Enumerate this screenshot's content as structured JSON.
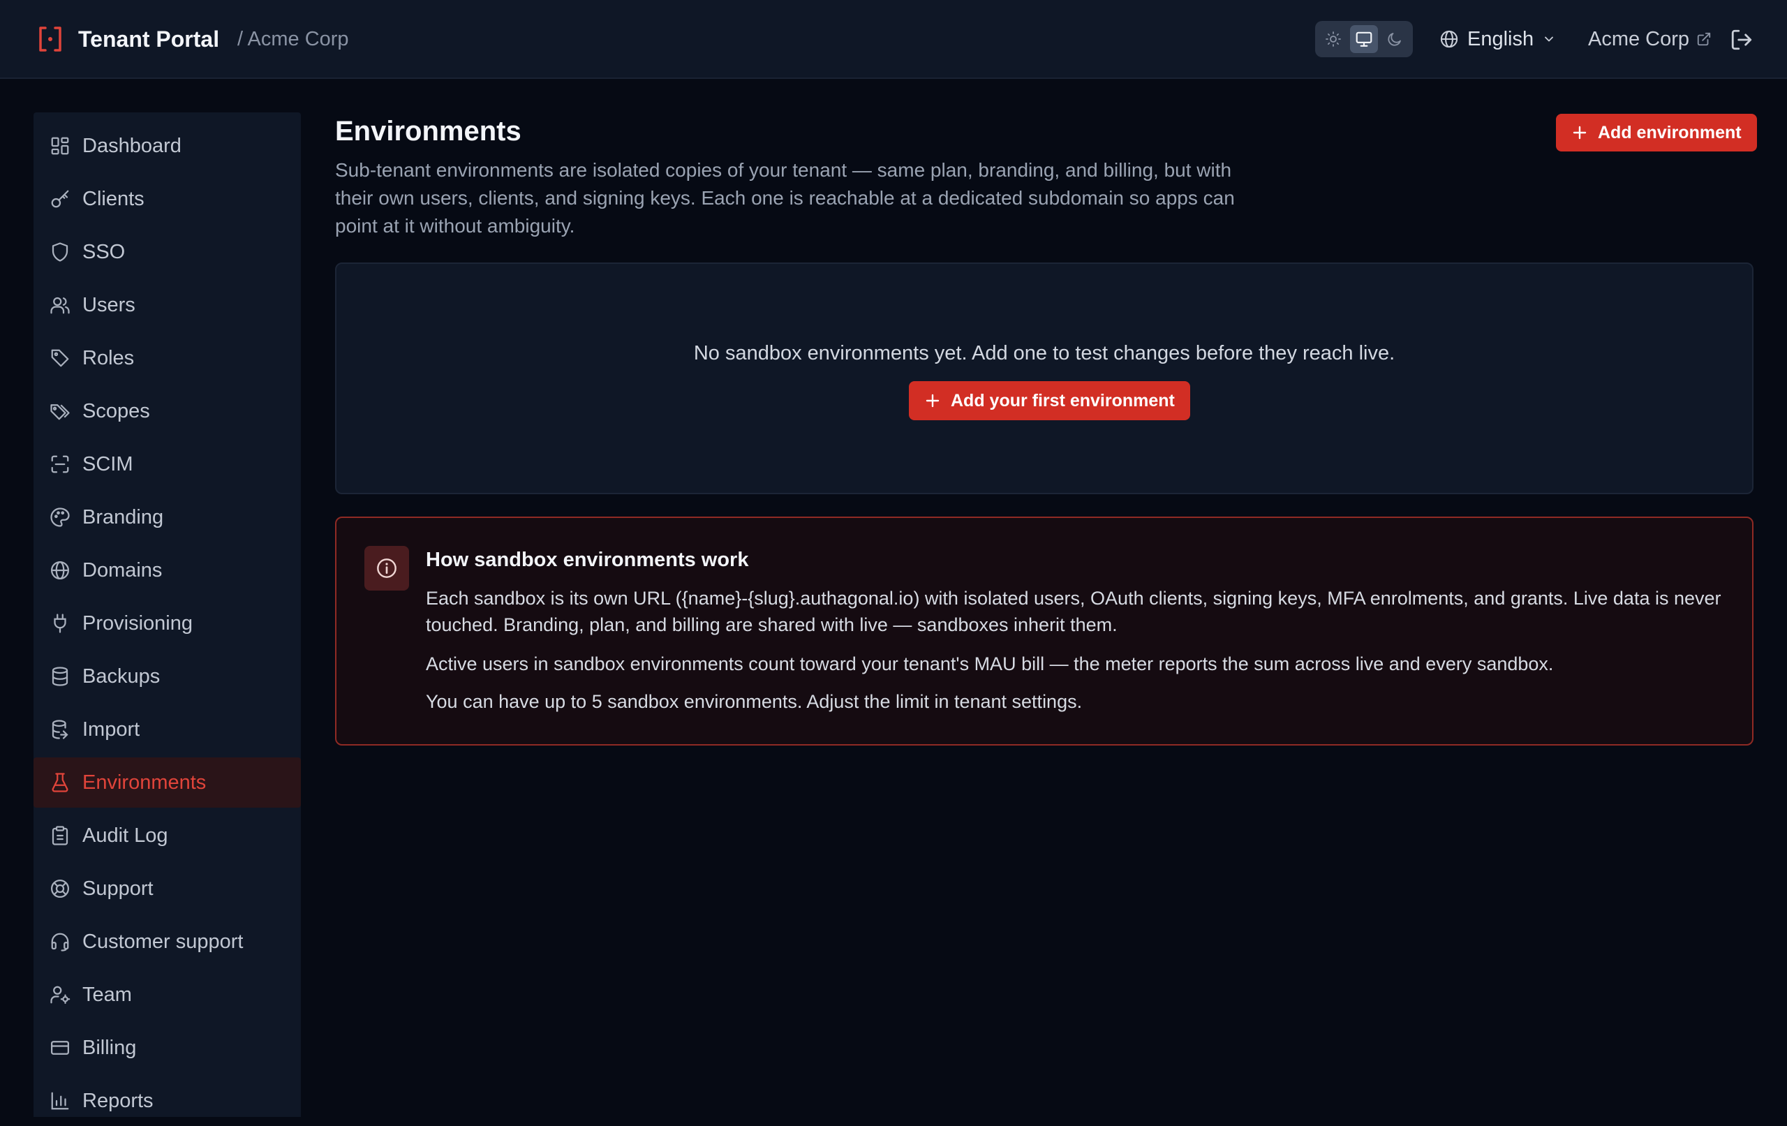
{
  "header": {
    "app_title": "Tenant Portal",
    "breadcrumb_sep": "/ Acme Corp",
    "theme_options": [
      "light-icon",
      "monitor-icon",
      "moon-icon"
    ],
    "theme_selected": "system",
    "language": "English",
    "tenant_link": "Acme Corp"
  },
  "sidebar": {
    "items": [
      {
        "label": "Dashboard",
        "icon": "dashboard-icon"
      },
      {
        "label": "Clients",
        "icon": "key-icon"
      },
      {
        "label": "SSO",
        "icon": "shield-icon"
      },
      {
        "label": "Users",
        "icon": "users-icon"
      },
      {
        "label": "Roles",
        "icon": "tag-icon"
      },
      {
        "label": "Scopes",
        "icon": "tags-icon"
      },
      {
        "label": "SCIM",
        "icon": "scan-icon"
      },
      {
        "label": "Branding",
        "icon": "palette-icon"
      },
      {
        "label": "Domains",
        "icon": "globe-icon"
      },
      {
        "label": "Provisioning",
        "icon": "plug-icon"
      },
      {
        "label": "Backups",
        "icon": "database-icon"
      },
      {
        "label": "Import",
        "icon": "database-import-icon"
      },
      {
        "label": "Environments",
        "icon": "flask-icon"
      },
      {
        "label": "Audit Log",
        "icon": "clipboard-icon"
      },
      {
        "label": "Support",
        "icon": "lifebuoy-icon"
      },
      {
        "label": "Customer support",
        "icon": "headset-icon"
      },
      {
        "label": "Team",
        "icon": "user-cog-icon"
      },
      {
        "label": "Billing",
        "icon": "credit-card-icon"
      },
      {
        "label": "Reports",
        "icon": "bar-chart-icon"
      }
    ],
    "active": "Environments"
  },
  "main": {
    "title": "Environments",
    "description": "Sub-tenant environments are isolated copies of your tenant — same plan, branding, and billing, but with their own users, clients, and signing keys. Each one is reachable at a dedicated subdomain so apps can point at it without ambiguity.",
    "add_button": "Add environment",
    "empty_text": "No sandbox environments yet. Add one to test changes before they reach live.",
    "add_first_button": "Add your first environment",
    "info": {
      "title": "How sandbox environments work",
      "paragraphs": [
        "Each sandbox is its own URL ({name}-{slug}.authagonal.io) with isolated users, OAuth clients, signing keys, MFA enrolments, and grants. Live data is never touched. Branding, plan, and billing are shared with live — sandboxes inherit them.",
        "Active users in sandbox environments count toward your tenant's MAU bill — the meter reports the sum across live and every sandbox.",
        "You can have up to 5 sandbox environments. Adjust the limit in tenant settings."
      ]
    }
  },
  "colors": {
    "accent": "#d22e24",
    "active_nav_text": "#e0443a",
    "background": "#060a14",
    "panel": "#0f1726"
  }
}
